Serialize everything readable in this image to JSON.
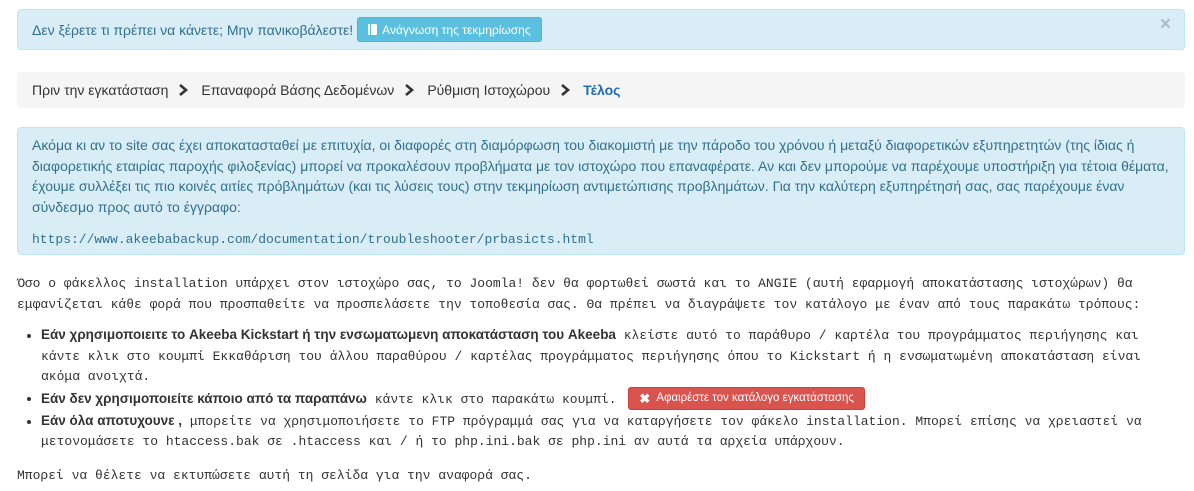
{
  "help_alert": {
    "message": "Δεν ξέρετε τι πρέπει να κάνετε; Μην πανικοβάλεστε!",
    "button_label": "Ανάγνωση της τεκμηρίωσης",
    "button_icon": "book-icon",
    "close_label": "×"
  },
  "breadcrumb": [
    {
      "label": "Πριν την εγκατάσταση",
      "active": false
    },
    {
      "label": "Επαναφορά Βάσης Δεδομένων",
      "active": false
    },
    {
      "label": "Ρύθμιση Ιστοχώρου",
      "active": false
    },
    {
      "label": "Τέλος",
      "active": true
    }
  ],
  "info_alert": {
    "text": "Ακόμα κι αν το site σας έχει αποκατασταθεί με επιτυχία, οι διαφορές στη διαμόρφωση του διακομιστή με την πάροδο του χρόνου ή μεταξύ διαφορετικών εξυπηρετητών (της ίδιας ή διαφορετικής εταιρίας παροχής φιλοξενίας) μπορεί να προκαλέσουν προβλήματα με τον ιστοχώρο που επαναφέρατε. Αν και δεν μπορούμε να παρέχουμε υποστήριξη για τέτοια θέματα, έχουμε συλλέξει τις πιο κοινές αιτίες πρόβλημάτων (και τις λύσεις τους) στην τεκμηρίωση αντιμετώπισης προβλημάτων. Για την καλύτερη εξυπηρέτησή σας, σας παρέχουμε έναν σύνδεσμο προς αυτό το έγγραφο:",
    "url": "https://www.akeebabackup.com/documentation/troubleshooter/prbasicts.html"
  },
  "intro": "Όσο ο φάκελλος installation υπάρχει στον ιστοχώρο σας, το Joomla! δεν θα φορτωθεί σωστά και το ANGIE (αυτή εφαρμογή αποκατάστασης ιστοχώρων) θα εμφανίζεται κάθε φορά που προσπαθείτε να προσπελάσετε την τοποθεσία σας. Θα πρέπει να διαγράψετε τον κατάλογο με έναν από τους παρακάτω τρόπους:",
  "methods": [
    {
      "bold": "Εάν χρησιμοποιειτε το Akeeba Kickstart ή την ενσωματωμενη αποκατάσταση του Akeeba",
      "text": " κλείστε αυτό το παράθυρο / καρτέλα του προγράμματος περιήγησης και κάντε κλικ στο κουμπί Εκκαθάριση του άλλου παραθύρου / καρτέλας προγράμματος περιήγησης όπου το Kickstart ή η ενσωματωμένη αποκατάσταση είναι ακόμα ανοιχτά."
    },
    {
      "bold": "Εάν δεν χρησιμοποιείτε κάποιο από τα παραπάνω",
      "text": " κάντε κλικ στο παρακάτω κουμπί.",
      "button_label": "Αφαιρέστε τον κατάλογο εγκατάστασης",
      "button_icon": "remove-icon"
    },
    {
      "bold": "Εάν όλα αποτυχουνε ,",
      "text": " μπορείτε να χρησιμοποιήσετε το FTP πρόγραμμά σας για να καταργήσετε τον φάκελο installation. Μπορεί επίσης να χρειαστεί να μετονομάσετε το htaccess.bak σε .htaccess και / ή το php.ini.bak σε php.ini αν αυτά τα αρχεία υπάρχουν."
    }
  ],
  "footnote": "Μπορεί να θέλετε να εκτυπώσετε αυτή τη σελίδα για την αναφορά σας.",
  "colors": {
    "info_bg": "#d9edf7",
    "info_text": "#31708f",
    "danger": "#d9534f",
    "link_active": "#1f6db5"
  }
}
